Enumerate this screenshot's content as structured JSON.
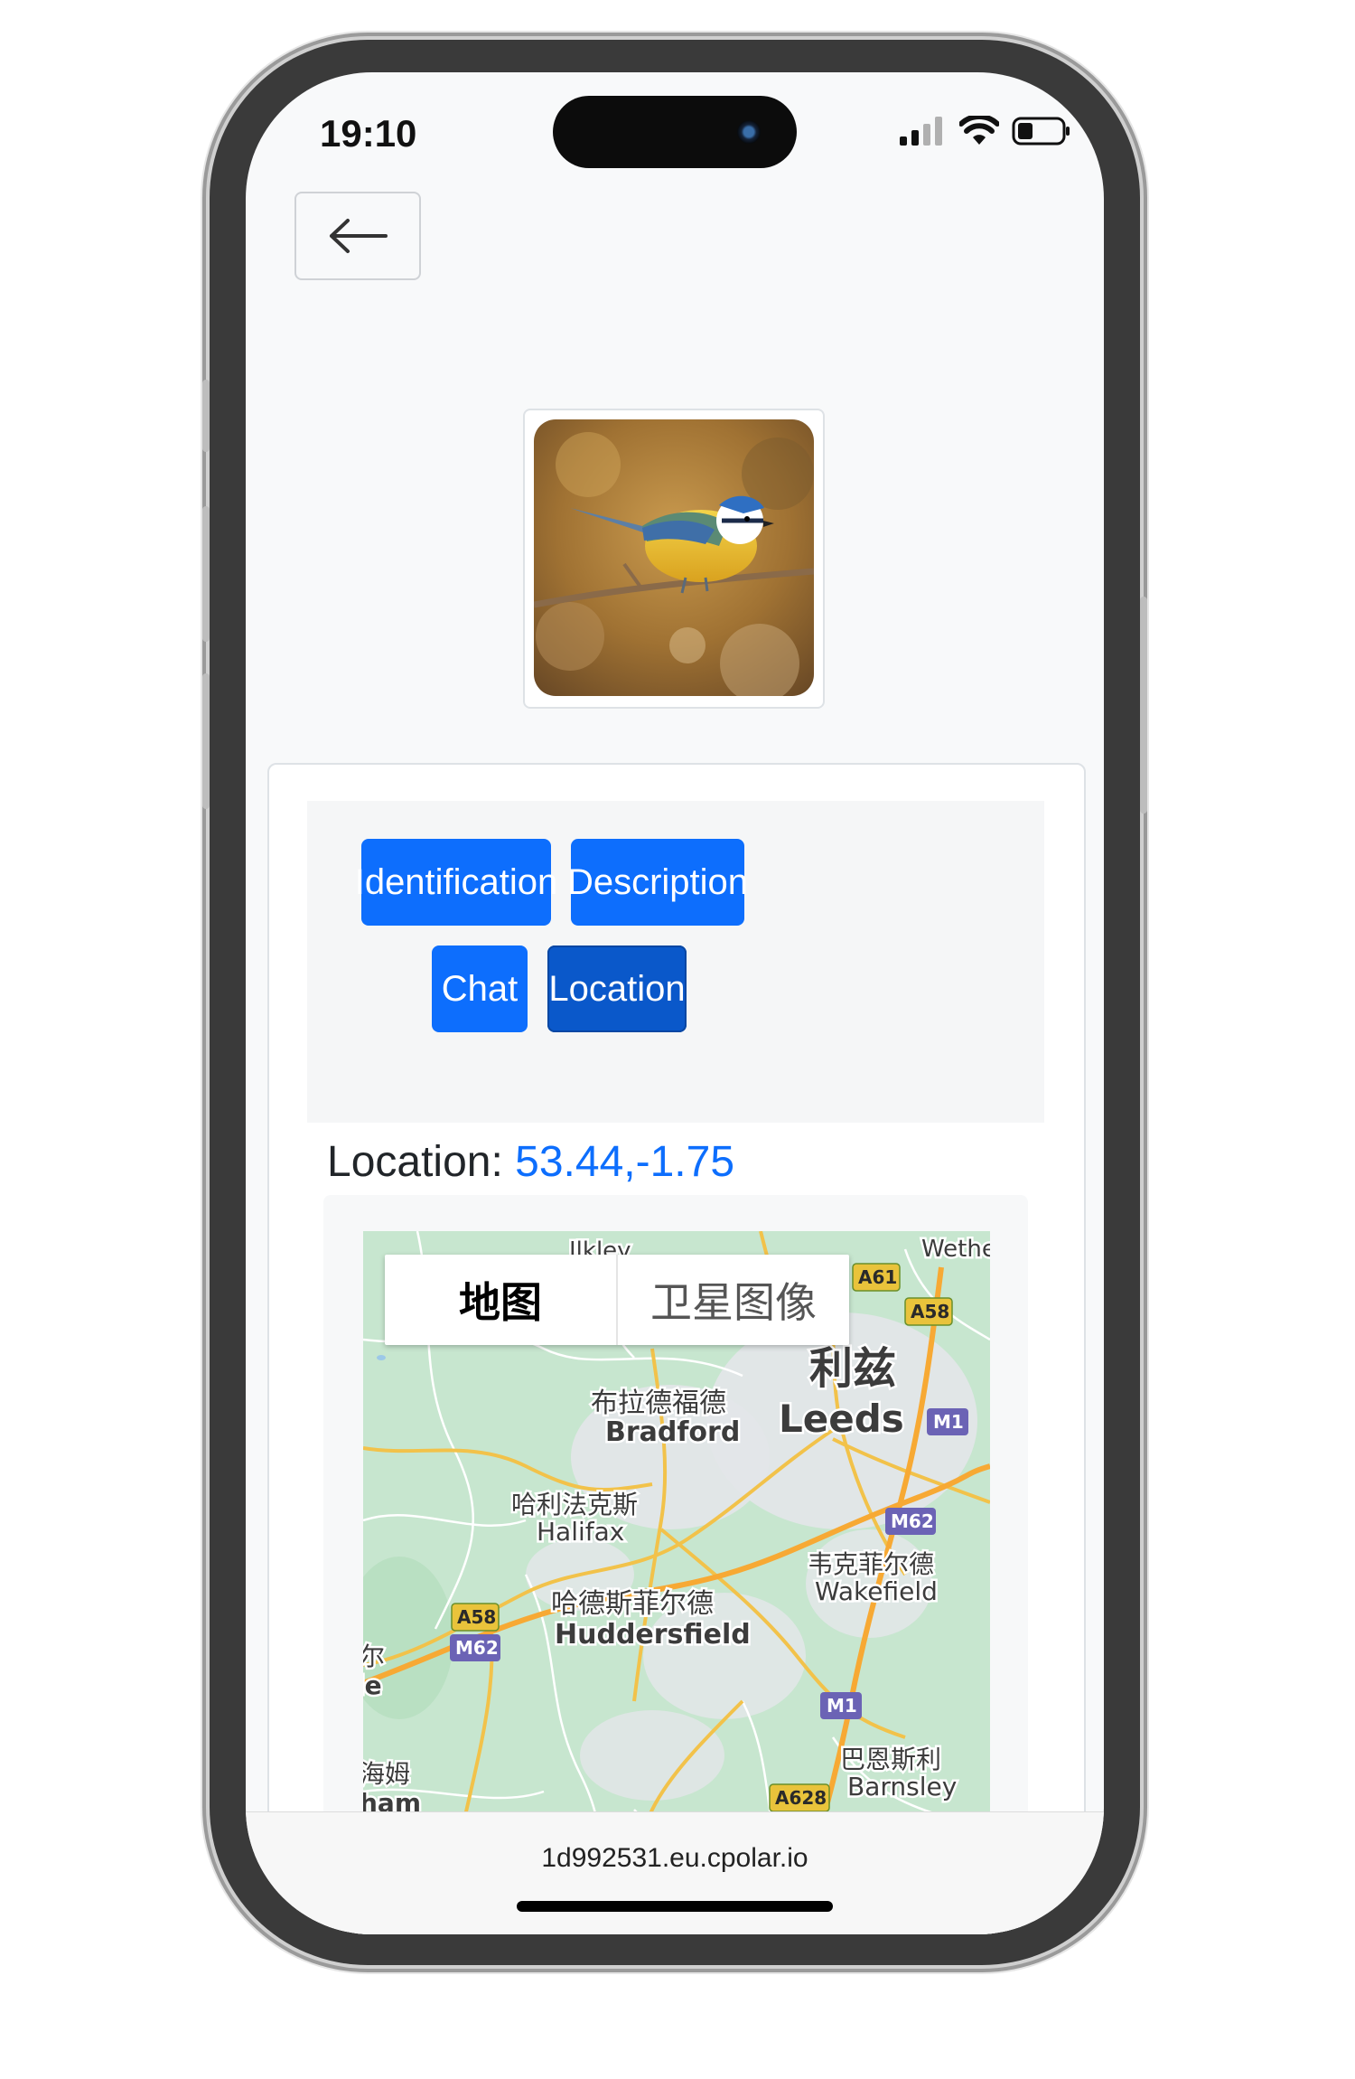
{
  "status_bar": {
    "time": "19:10"
  },
  "nav": {
    "back_icon": "arrow-left-icon"
  },
  "bird_image": {
    "subject": "blue tit on branch"
  },
  "tabs": [
    {
      "label": "Identification",
      "active": false
    },
    {
      "label": "Description",
      "active": false
    },
    {
      "label": "Chat",
      "active": false
    },
    {
      "label": "Location",
      "active": true
    }
  ],
  "location": {
    "label": "Location:",
    "coordinates": "53.44,-1.75"
  },
  "map": {
    "type_control": {
      "map_label": "地图",
      "satellite_label": "卫星图像",
      "selected": "map"
    },
    "places": [
      {
        "zh": "利兹",
        "en": "Leeds"
      },
      {
        "zh": "布拉德福德",
        "en": "Bradford"
      },
      {
        "zh": "哈利法克斯",
        "en": "Halifax"
      },
      {
        "zh": "韦克菲尔德",
        "en": "Wakefield"
      },
      {
        "zh": "哈德斯菲尔德",
        "en": "Huddersfield"
      },
      {
        "zh": "巴恩斯利",
        "en": "Barnsley"
      },
      {
        "partial_top": "Ilkley"
      },
      {
        "partial_top": "Wethe"
      },
      {
        "partial_left_1_zh": "尔",
        "partial_left_1_en": "le"
      },
      {
        "partial_left_2_zh": "海姆",
        "partial_left_2_en": "ham"
      }
    ],
    "road_shields": [
      "A61",
      "A58",
      "M1",
      "M62",
      "A58",
      "M62",
      "M1",
      "A628"
    ]
  },
  "browser": {
    "url": "1d992531.eu.cpolar.io"
  },
  "colors": {
    "primary": "#0d6efd",
    "primary_active": "#0a58ca",
    "map_green": "#c7e6cf"
  }
}
